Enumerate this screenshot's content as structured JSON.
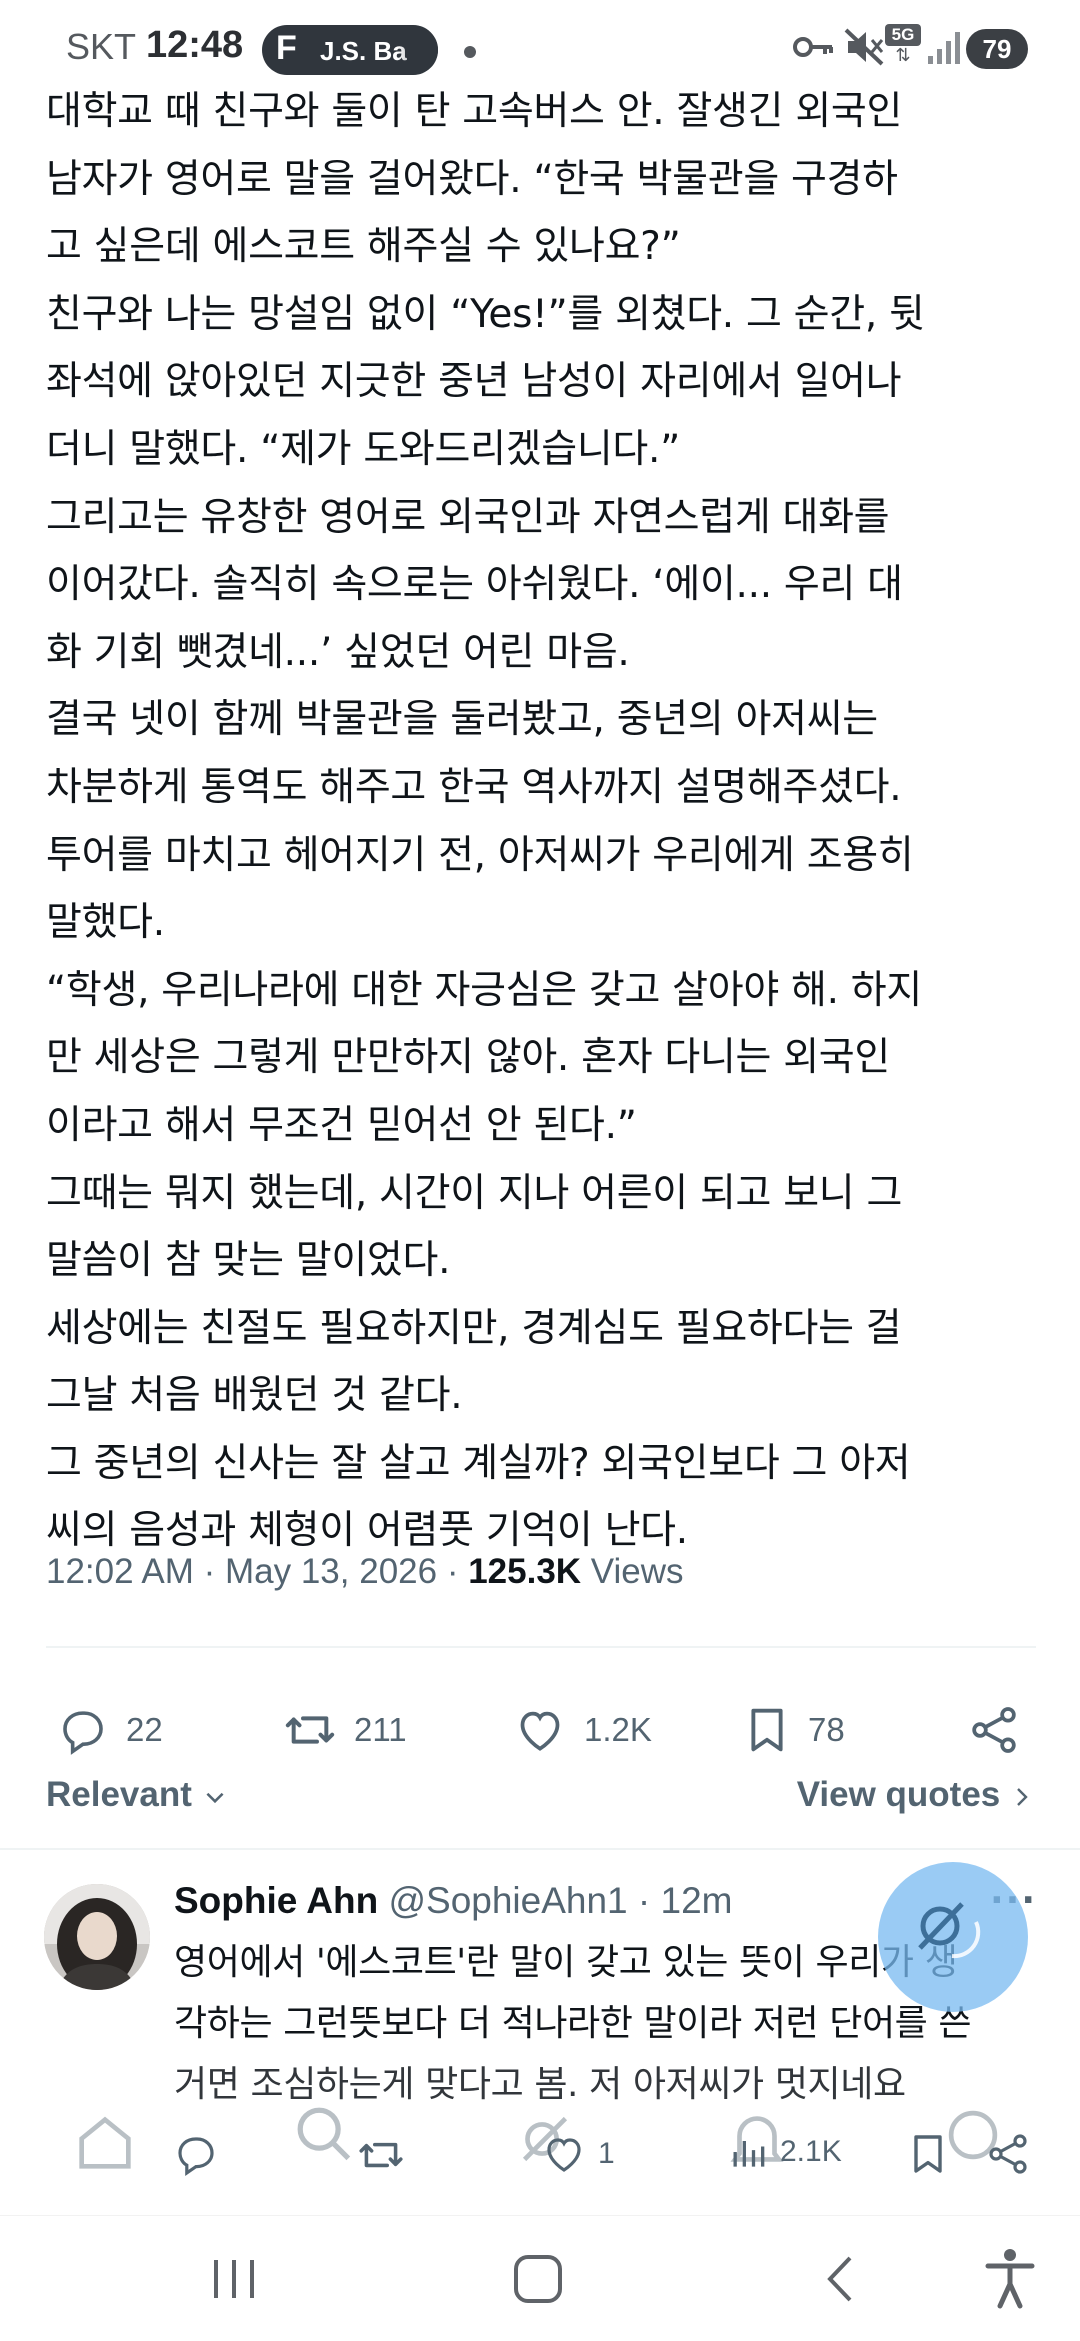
{
  "status_bar": {
    "carrier": "SKT",
    "time": "12:48",
    "notification_pill": "J.S. Ba",
    "network": "5G",
    "battery": "79"
  },
  "tweet": {
    "lines": [
      "대학교 때 친구와 둘이 탄 고속버스 안. 잘생긴 외국인",
      "남자가 영어로 말을 걸어왔다. “한국 박물관을 구경하",
      "고 싶은데 에스코트 해주실 수 있나요?”",
      "친구와 나는 망설임 없이 “Yes!”를 외쳤다. 그 순간, 뒷",
      "좌석에 앉아있던 지긋한 중년 남성이 자리에서 일어나",
      "더니 말했다. “제가 도와드리겠습니다.”",
      "그리고는 유창한 영어로 외국인과 자연스럽게 대화를",
      "이어갔다. 솔직히 속으로는 아쉬웠다. ‘에이... 우리 대",
      "화 기회 뺏겼네...’ 싶었던 어린 마음.",
      "결국 넷이 함께 박물관을 둘러봤고, 중년의 아저씨는",
      "차분하게 통역도 해주고 한국 역사까지 설명해주셨다.",
      "투어를 마치고 헤어지기 전, 아저씨가 우리에게 조용히",
      "말했다.",
      "“학생, 우리나라에 대한 자긍심은 갖고 살아야 해. 하지",
      "만 세상은 그렇게 만만하지 않아. 혼자 다니는 외국인",
      "이라고 해서 무조건 믿어선 안 된다.”",
      "그때는 뭐지 했는데, 시간이 지나 어른이 되고 보니 그",
      "말씀이 참 맞는 말이었다.",
      "세상에는 친절도 필요하지만, 경계심도 필요하다는 걸",
      "그날 처음 배웠던 것 같다.",
      "그 중년의 신사는 잘 살고 계실까? 외국인보다 그 아저",
      "씨의 음성과 체형이 어렴풋 기억이 난다."
    ],
    "time": "12:02 AM",
    "sep1": " · ",
    "date": "May 13, 2026",
    "sep2": " · ",
    "views_count": "125.3K",
    "views_label": " Views",
    "replies": "22",
    "reposts": "211",
    "likes": "1.2K",
    "bookmarks": "78"
  },
  "sort": {
    "label": "Relevant",
    "view_quotes": "View quotes"
  },
  "reply": {
    "name": "Sophie Ahn",
    "handle": " @SophieAhn1",
    "time": " · 12m",
    "more": "···",
    "lines": [
      "영어에서 '에스코트'란 말이 갖고 있는 뜻이 우리가 생",
      "각하는 그런뜻보다 더 적나라한 말이라 저런 단어를 쓴",
      "거면 조심하는게 맞다고 봄. 저 아저씨가 멋지네요"
    ],
    "likes": "1",
    "views": "2.1K"
  },
  "colors": {
    "text": "#0f1419",
    "secondary": "#536471",
    "divider": "#eff3f4",
    "fab": "#78b9f0"
  }
}
